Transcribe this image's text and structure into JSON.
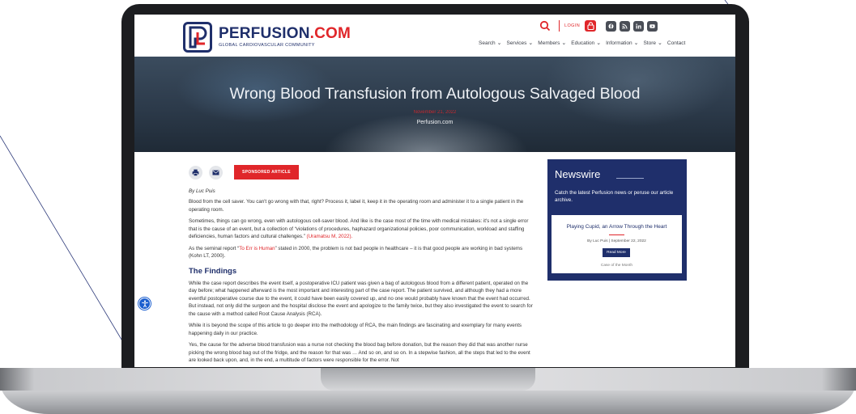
{
  "header": {
    "logo_name_primary": "PERFUSION",
    "logo_name_suffix": ".COM",
    "logo_tagline": "GLOBAL CARDIOVASCULAR COMMUNITY",
    "login_label": "LOGIN",
    "nav": [
      {
        "label": "Search",
        "has_menu": true
      },
      {
        "label": "Services",
        "has_menu": true
      },
      {
        "label": "Members",
        "has_menu": true
      },
      {
        "label": "Education",
        "has_menu": true
      },
      {
        "label": "Information",
        "has_menu": true
      },
      {
        "label": "Store",
        "has_menu": true
      },
      {
        "label": "Contact",
        "has_menu": false
      }
    ],
    "social_icons": [
      "facebook-icon",
      "rss-icon",
      "linkedin-icon",
      "youtube-icon"
    ]
  },
  "hero": {
    "title": "Wrong Blood Transfusion from Autologous Salvaged Blood",
    "date": "November 21, 2022",
    "source": "Perfusion.com"
  },
  "article": {
    "sponsored_label": "SPONSORED ARTICLE",
    "byline": "By Luc Puis",
    "paragraphs": [
      "Blood from the cell saver. You can't go wrong with that, right? Process it, label it, keep it in the operating room and administer it to a single patient in the operating room.",
      "Sometimes, things can go wrong, even with autologous cell-saver blood. And like is the case most of the time with medical mistakes: it's not a single error that is the cause of an event, but a collection of “violations of procedures, haphazard organizational policies, poor communication, workload and staffing deficiencies, human factors and cultural challenges.”",
      "(Uramatsu M, 2022).",
      "As the seminal report “",
      "To Err is Human",
      "” stated in 2000, the problem is not bad people in healthcare – it is that good people are working in bad systems (Kohn LT, 2000)."
    ],
    "section_title": "The Findings",
    "findings": [
      "While the case report describes the event itself, a postoperative ICU patient was given a bag of autologous blood from a different patient, operated on the day before; what happened afterward is the most important and interesting part of the case report. The patient survived, and although they had a more eventful postoperative course due to the event, it could have been easily covered up, and no one would probably have known that the event had occurred. But instead, not only did the surgeon and the hospital disclose the event and apologize to the family twice, but they also investigated the event to search for the cause with a method called Root Cause Analysis (RCA).",
      "While it is beyond the scope of this article to go deeper into the methodology of RCA, the main findings are fascinating and exemplary for many events happening daily in our practice.",
      "Yes, the cause for the adverse blood transfusion was a nurse not checking the blood bag before donation, but the reason they did that was another nurse picking the wrong blood bag out of the fridge, and the reason for that was … And so on, and so on. In a stepwise fashion, all the steps that led to the event are looked back upon, and, in the end, a multitude of factors were responsible for the error. Not"
    ]
  },
  "sidebar": {
    "title": "Newswire",
    "description": "Catch the latest Perfusion news or peruse our article archive.",
    "card": {
      "title": "Playing Cupid, an Arrow Through the Heart",
      "meta": "By Luc Puis | September 22, 2022",
      "button": "Read More",
      "category": "Case of the Month"
    }
  },
  "colors": {
    "brand_navy": "#1f2f6b",
    "brand_red": "#e0262a",
    "a11y_blue": "#1c5fcf"
  }
}
